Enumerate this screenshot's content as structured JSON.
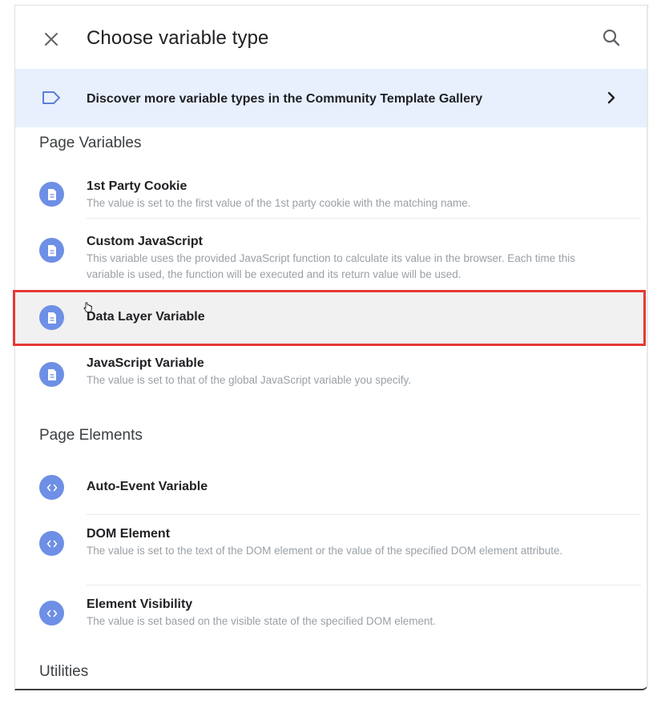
{
  "header": {
    "title": "Choose variable type",
    "close_icon": "close-icon",
    "search_icon": "search-icon"
  },
  "gallery": {
    "text": "Discover more variable types in the Community Template Gallery",
    "icon": "label-tag-icon",
    "chevron": "chevron-right-icon"
  },
  "sections": {
    "page_variables": {
      "title": "Page Variables",
      "items": [
        {
          "title": "1st Party Cookie",
          "desc": "The value is set to the first value of the 1st party cookie with the matching name.",
          "icon": "document-icon"
        },
        {
          "title": "Custom JavaScript",
          "desc": "This variable uses the provided JavaScript function to calculate its value in the browser. Each time this variable is used, the function will be executed and its return value will be used.",
          "icon": "document-icon"
        },
        {
          "title": "Data Layer Variable",
          "desc": "",
          "icon": "document-icon",
          "highlighted": true
        },
        {
          "title": "JavaScript Variable",
          "desc": "The value is set to that of the global JavaScript variable you specify.",
          "icon": "document-icon"
        }
      ]
    },
    "page_elements": {
      "title": "Page Elements",
      "items": [
        {
          "title": "Auto-Event Variable",
          "desc": "",
          "icon": "code-icon"
        },
        {
          "title": "DOM Element",
          "desc": "The value is set to the text of the DOM element or the value of the specified DOM element attribute.",
          "icon": "code-icon"
        },
        {
          "title": "Element Visibility",
          "desc": "The value is set based on the visible state of the specified DOM element.",
          "icon": "code-icon"
        }
      ]
    },
    "utilities": {
      "title": "Utilities"
    }
  },
  "colors": {
    "accent_icon": "#6e8fe6",
    "banner_bg": "#e8f0fe",
    "highlight_border": "#e53935",
    "highlight_bg": "#f1f1f1"
  }
}
